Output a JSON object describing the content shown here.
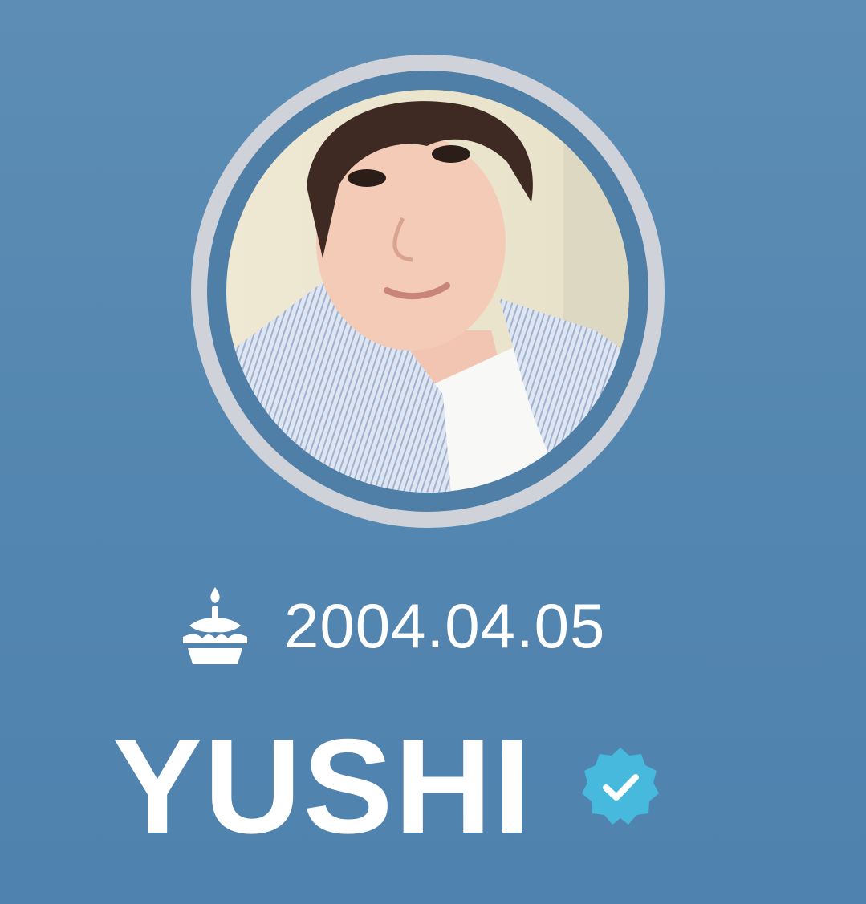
{
  "profile": {
    "birthday": "2004.04.05",
    "name": "YUSHI",
    "verified": true
  },
  "icons": {
    "birthday": "birthday-cake-icon",
    "verified": "verified-badge-icon"
  },
  "colors": {
    "background": "#5386b0",
    "ring_outer": "#cfd3d9",
    "ring_inner": "#4f7ea6",
    "verified_badge": "#47b9dc",
    "text": "#ffffff"
  }
}
